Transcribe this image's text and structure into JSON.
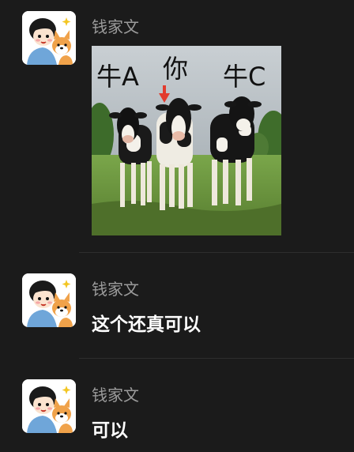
{
  "messages": [
    {
      "sender": "钱家文",
      "type": "image",
      "image": {
        "description": "three cows meme",
        "captions": [
          "牛A",
          "你",
          "牛C"
        ]
      }
    },
    {
      "sender": "钱家文",
      "type": "text",
      "text": "这个还真可以"
    },
    {
      "sender": "钱家文",
      "type": "text",
      "text": "可以"
    }
  ],
  "colors": {
    "background": "#1b1b1b",
    "sender": "#9b9b9b",
    "text": "#ffffff",
    "divider": "#2e2e2e",
    "arrow": "#e23b2e"
  },
  "icons": {
    "avatar": "boy-with-corgi-avatar",
    "arrow": "red-down-arrow-icon"
  }
}
